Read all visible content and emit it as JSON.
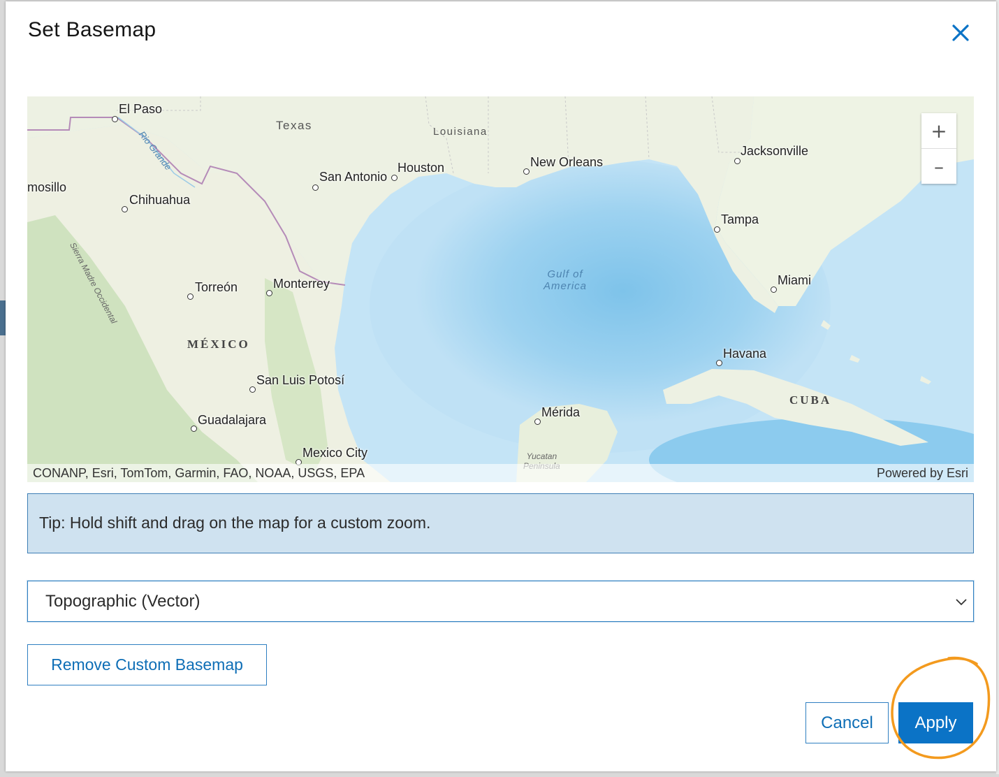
{
  "dialog": {
    "title": "Set Basemap",
    "close_icon": "close-icon"
  },
  "map": {
    "zoom_in_label": "+",
    "zoom_out_label": "–",
    "attribution_left": "CONANP, Esri, TomTom, Garmin, FAO, NOAA, USGS, EPA",
    "attribution_right": "Powered by Esri",
    "labels": {
      "el_paso": "El Paso",
      "texas": "Texas",
      "louisiana": "Louisiana",
      "houston": "Houston",
      "san_antonio": "San Antonio",
      "new_orleans": "New Orleans",
      "jacksonville": "Jacksonville",
      "hermosillo": "mosillo",
      "chihuahua": "Chihuahua",
      "tampa": "Tampa",
      "gulf_line1": "Gulf of",
      "gulf_line2": "America",
      "miami": "Miami",
      "torreon": "Torreón",
      "monterrey": "Monterrey",
      "mexico": "MÉXICO",
      "havana": "Havana",
      "cuba": "CUBA",
      "san_luis_potosi": "San Luis Potosí",
      "merida": "Mérida",
      "guadalajara": "Guadalajara",
      "mexico_city": "Mexico City",
      "yucatan_line1": "Yucatan",
      "yucatan_line2": "Peninsula",
      "rio_grande": "Rio Grande",
      "sierra_madre": "Sierra Madre Occidental"
    }
  },
  "tip": {
    "text": "Tip: Hold shift and drag on the map for a custom zoom."
  },
  "basemap_select": {
    "selected": "Topographic (Vector)"
  },
  "buttons": {
    "remove_custom": "Remove Custom Basemap",
    "cancel": "Cancel",
    "apply": "Apply"
  },
  "colors": {
    "accent": "#0b73c6",
    "annotation": "#f39a1e",
    "tip_background": "#cfe2f0"
  }
}
